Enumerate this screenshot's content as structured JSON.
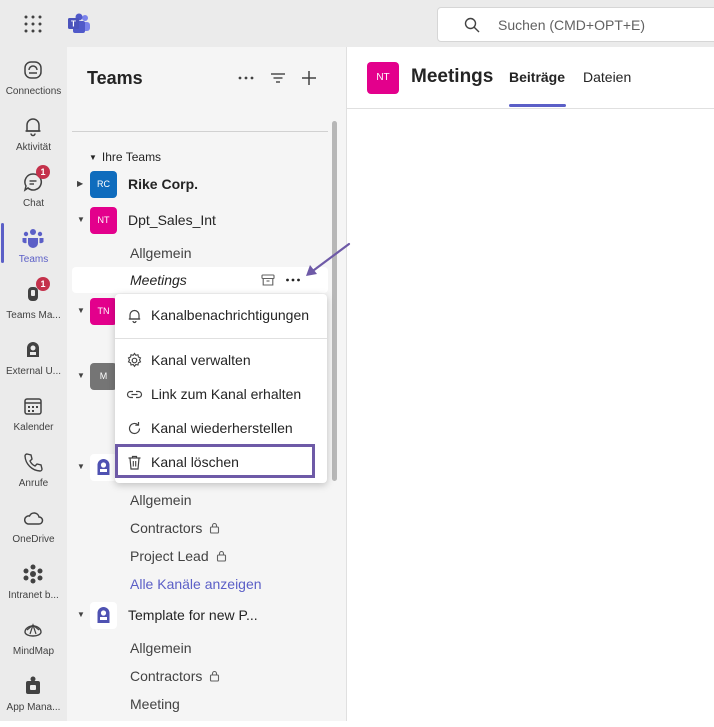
{
  "app": {
    "name": "Microsoft Teams"
  },
  "search": {
    "placeholder": "Suchen (CMD+OPT+E)"
  },
  "rail": {
    "items": [
      {
        "label": "Connections",
        "icon": "connections-icon"
      },
      {
        "label": "Aktivität",
        "icon": "bell-icon"
      },
      {
        "label": "Chat",
        "icon": "chat-icon",
        "badge": "1"
      },
      {
        "label": "Teams",
        "icon": "teams-icon",
        "active": true
      },
      {
        "label": "Teams Ma...",
        "icon": "teams-manager-icon",
        "badge": "1"
      },
      {
        "label": "External U...",
        "icon": "external-user-icon"
      },
      {
        "label": "Kalender",
        "icon": "calendar-icon"
      },
      {
        "label": "Anrufe",
        "icon": "phone-icon"
      },
      {
        "label": "OneDrive",
        "icon": "cloud-icon"
      },
      {
        "label": "Intranet b...",
        "icon": "intranet-icon"
      },
      {
        "label": "MindMap",
        "icon": "mindmap-icon"
      },
      {
        "label": "App Mana...",
        "icon": "app-manager-icon"
      }
    ]
  },
  "panel": {
    "title": "Teams",
    "section_label": "Ihre Teams",
    "teams": [
      {
        "initials": "RC",
        "name": "Rike Corp.",
        "color": "#0f6cbd"
      },
      {
        "initials": "NT",
        "name": "Dpt_Sales_Int",
        "color": "#e3008c"
      },
      {
        "initials": "TN",
        "name": "",
        "color": "#e3008c"
      },
      {
        "initials": "M",
        "name": "",
        "color": "#757575"
      },
      {
        "initials": "",
        "name": "",
        "icon": "robot-icon"
      },
      {
        "initials": "",
        "name": "Template for new P...",
        "icon": "robot-icon"
      }
    ],
    "channels_sales": [
      "Allgemein",
      "Meetings"
    ],
    "channels_team5": [
      "Allgemein",
      "Contractors",
      "Project Lead",
      "Alle Kanäle anzeigen"
    ],
    "channels_team6": [
      "Allgemein",
      "Contractors",
      "Meeting"
    ]
  },
  "context_menu": {
    "items": [
      {
        "label": "Kanalbenachrichtigungen",
        "icon": "bell-icon"
      },
      {
        "label": "Kanal verwalten",
        "icon": "gear-icon"
      },
      {
        "label": "Link zum Kanal erhalten",
        "icon": "link-icon"
      },
      {
        "label": "Kanal wiederherstellen",
        "icon": "restore-icon"
      },
      {
        "label": "Kanal löschen",
        "icon": "trash-icon"
      }
    ]
  },
  "main": {
    "avatar_initials": "NT",
    "channel_title": "Meetings",
    "tabs": [
      "Beiträge",
      "Dateien"
    ]
  },
  "colors": {
    "accent": "#5b5fc7",
    "highlight": "#6e5aa7",
    "badge": "#c4314b"
  }
}
